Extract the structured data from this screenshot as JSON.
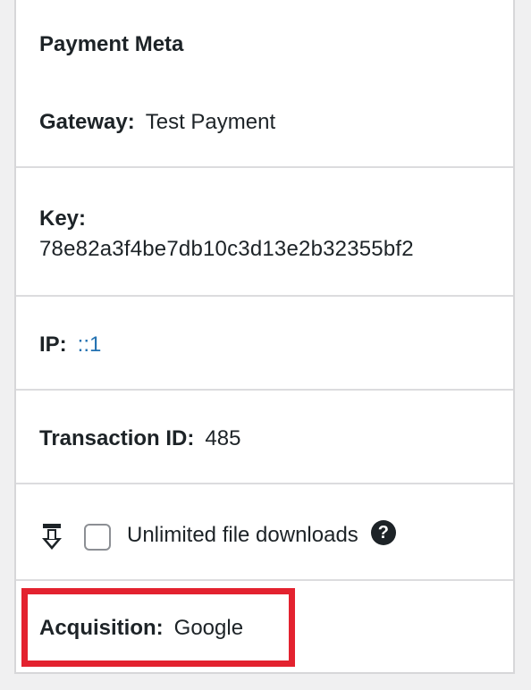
{
  "box": {
    "title": "Payment Meta"
  },
  "gateway": {
    "label": "Gateway:",
    "value": "Test Payment"
  },
  "key": {
    "label": "Key:",
    "value": "78e82a3f4be7db10c3d13e2b32355bf2"
  },
  "ip": {
    "label": "IP:",
    "value": "::1"
  },
  "transaction": {
    "label": "Transaction ID:",
    "value": "485"
  },
  "unlimited": {
    "label": "Unlimited file downloads",
    "checked": false,
    "help_glyph": "?"
  },
  "acquisition": {
    "label": "Acquisition:",
    "value": "Google"
  },
  "colors": {
    "link": "#2271b1",
    "highlight": "#e3222f"
  },
  "icons": [
    "download-icon",
    "help-icon"
  ]
}
